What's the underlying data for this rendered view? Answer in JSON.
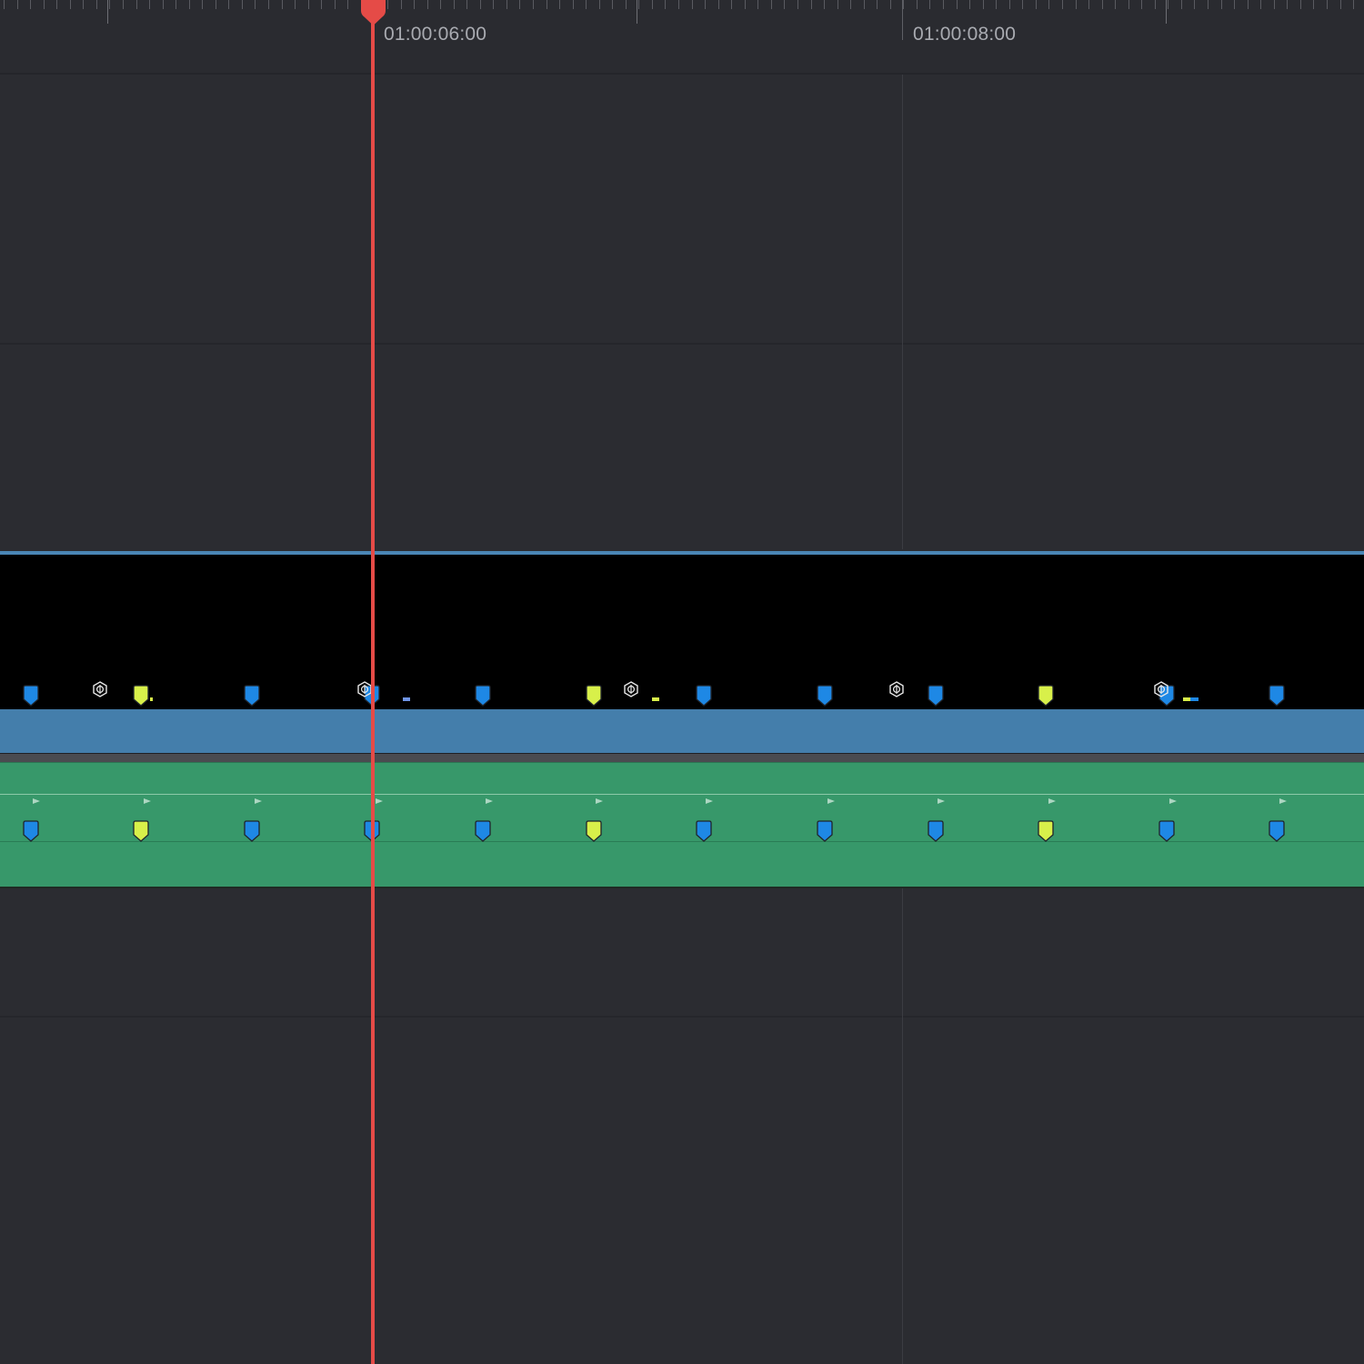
{
  "ruler": {
    "timecode_labels": [
      "01:00:06:00",
      "01:00:08:00"
    ]
  },
  "colors": {
    "background": "#2b2c31",
    "playhead": "#e54b47",
    "video_clip": "#447eab",
    "audio_clip": "#37986a",
    "marker_blue": "#1e88e5",
    "marker_yellow": "#d8f04a"
  },
  "video_track": {
    "clip_color": "#447eab",
    "markers": [
      {
        "color": "blue"
      },
      {
        "color": "yellow"
      },
      {
        "color": "blue"
      },
      {
        "color": "blue"
      },
      {
        "color": "blue"
      },
      {
        "color": "yellow"
      },
      {
        "color": "blue"
      },
      {
        "color": "blue"
      },
      {
        "color": "blue"
      },
      {
        "color": "yellow"
      },
      {
        "color": "blue"
      },
      {
        "color": "blue"
      }
    ],
    "compound_icons": [
      "compound-clip-icon",
      "compound-clip-icon",
      "compound-clip-icon",
      "compound-clip-icon",
      "compound-clip-icon"
    ]
  },
  "audio_track": {
    "clip_color": "#37986a",
    "markers": [
      {
        "color": "blue"
      },
      {
        "color": "yellow"
      },
      {
        "color": "blue"
      },
      {
        "color": "blue"
      },
      {
        "color": "blue"
      },
      {
        "color": "yellow"
      },
      {
        "color": "blue"
      },
      {
        "color": "blue"
      },
      {
        "color": "blue"
      },
      {
        "color": "yellow"
      },
      {
        "color": "blue"
      },
      {
        "color": "blue"
      }
    ]
  }
}
